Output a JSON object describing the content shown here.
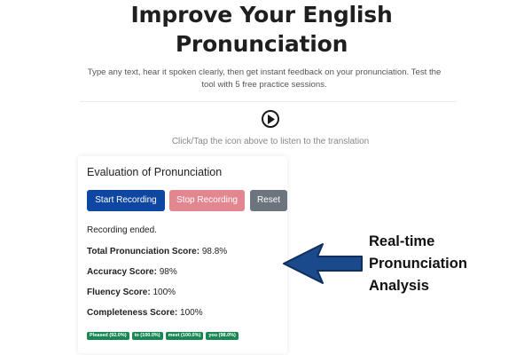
{
  "header": {
    "title_line1": "Improve Your English",
    "title_line2": "Pronunciation",
    "subtitle_line1": "Type any text, hear it spoken clearly, then get instant feedback on your pronunciation. Test the",
    "subtitle_line2": "tool with 5 free practice sessions."
  },
  "player": {
    "play_icon": "play-circle-icon",
    "hint": "Click/Tap the icon above to listen to the translation"
  },
  "evaluation": {
    "title": "Evaluation of Pronunciation",
    "buttons": {
      "start": "Start Recording",
      "stop": "Stop Recording",
      "reset": "Reset"
    },
    "status": "Recording ended.",
    "scores": [
      {
        "label": "Total Pronunciation Score:",
        "value": "98.8%"
      },
      {
        "label": "Accuracy Score:",
        "value": "98%"
      },
      {
        "label": "Fluency Score:",
        "value": "100%"
      },
      {
        "label": "Completeness Score:",
        "value": "100%"
      }
    ],
    "word_badges": [
      "Pleased (92.0%)",
      "to (100.0%)",
      "meet (100.0%)",
      "you (98.0%)"
    ]
  },
  "callout": {
    "line1": "Real-time",
    "line2": "Pronunciation",
    "line3": "Analysis"
  },
  "colors": {
    "start_button": "#0d47a1",
    "stop_button": "#e2868f",
    "reset_button": "#6c757d",
    "badge": "#198754",
    "arrow": "#1b4a8c"
  }
}
